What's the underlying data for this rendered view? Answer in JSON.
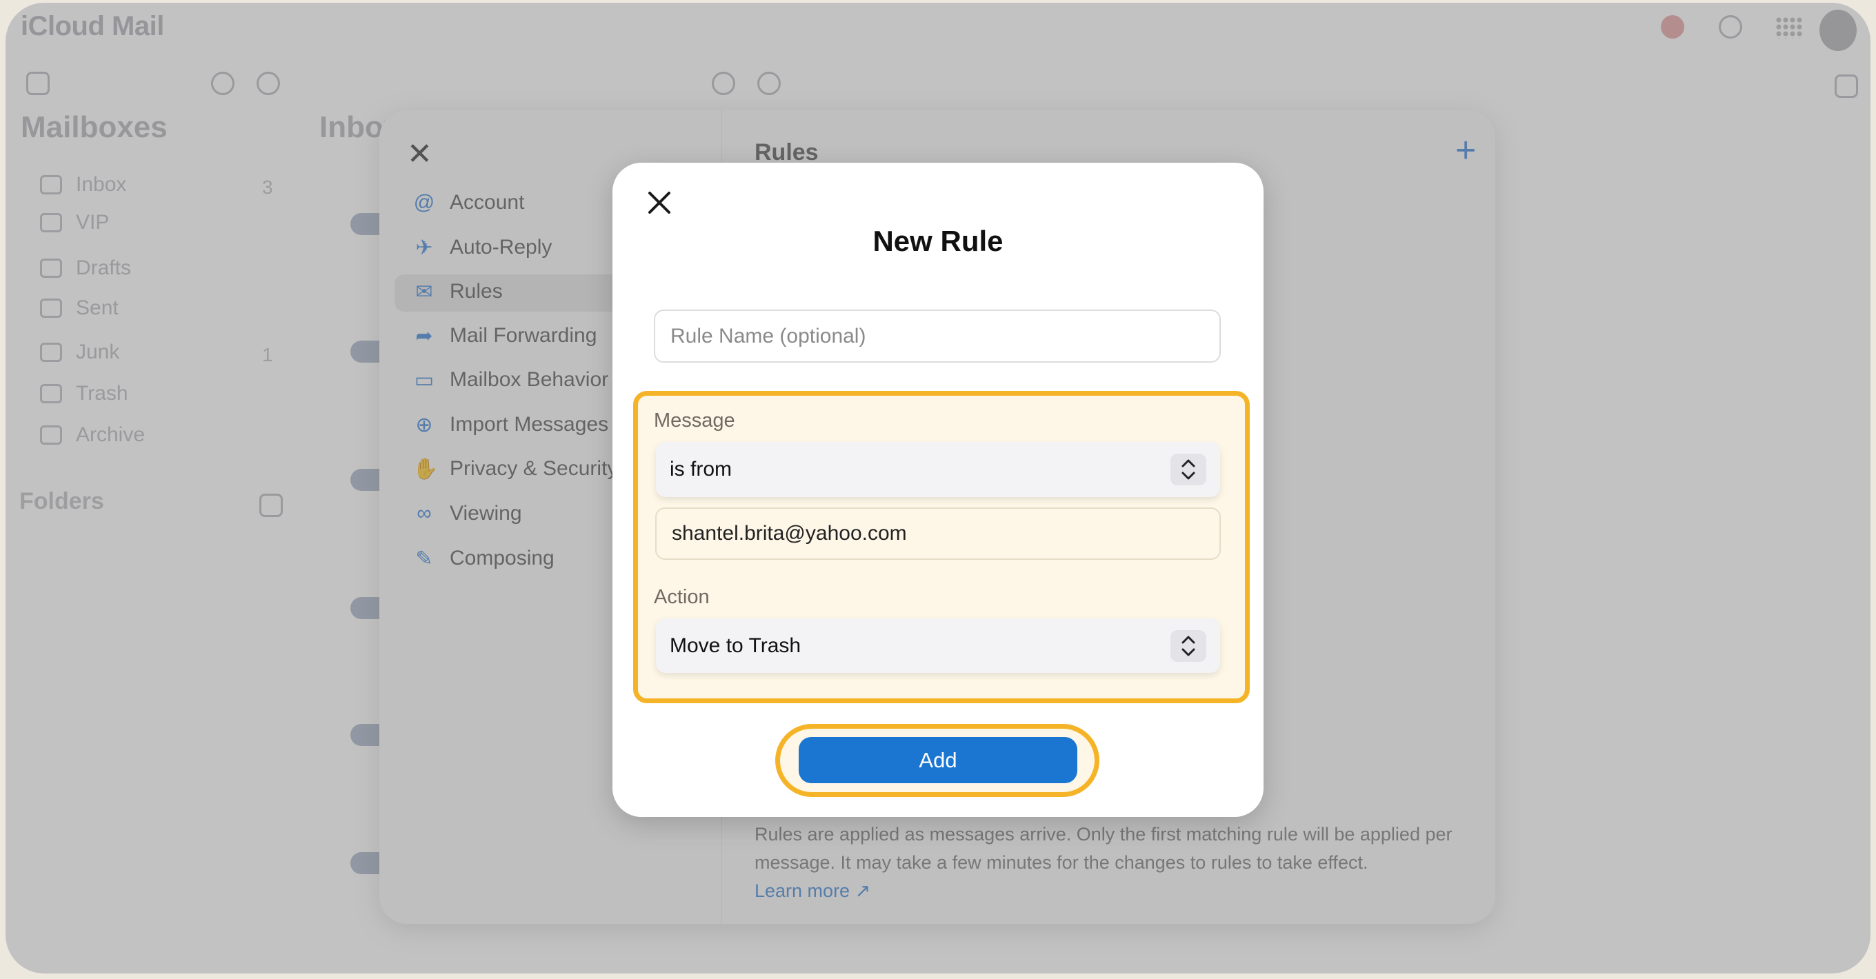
{
  "app": {
    "title": "iCloud Mail"
  },
  "sidebar": {
    "heading": "Mailboxes",
    "items": [
      {
        "label": "Inbox",
        "count": "3"
      },
      {
        "label": "VIP",
        "count": ""
      },
      {
        "label": "Drafts",
        "count": ""
      },
      {
        "label": "Sent",
        "count": ""
      },
      {
        "label": "Junk",
        "count": "1"
      },
      {
        "label": "Trash",
        "count": ""
      },
      {
        "label": "Archive",
        "count": ""
      }
    ],
    "folders_heading": "Folders"
  },
  "message_list": {
    "heading": "Inbox"
  },
  "settings": {
    "menu": [
      {
        "label": "Account",
        "icon": "@"
      },
      {
        "label": "Auto-Reply",
        "icon": "✈"
      },
      {
        "label": "Rules",
        "icon": "✉"
      },
      {
        "label": "Mail Forwarding",
        "icon": "➦"
      },
      {
        "label": "Mailbox Behavior",
        "icon": "▭"
      },
      {
        "label": "Import Messages",
        "icon": "⊕"
      },
      {
        "label": "Privacy & Security",
        "icon": "✋"
      },
      {
        "label": "Viewing",
        "icon": "∞"
      },
      {
        "label": "Composing",
        "icon": "✎"
      }
    ],
    "active": "Rules",
    "rules_heading": "Rules",
    "footer_text": "Rules are applied as messages arrive. Only the first matching rule will be applied per message. It may take a few minutes for the changes to rules to take effect.",
    "learn_more": "Learn more ↗"
  },
  "modal": {
    "title": "New Rule",
    "rule_name_placeholder": "Rule Name (optional)",
    "message_label": "Message",
    "condition_value": "is from",
    "email_value": "shantel.brita@yahoo.com",
    "action_label": "Action",
    "action_value": "Move to Trash",
    "add_label": "Add"
  },
  "colors": {
    "accent": "#1b76d2",
    "highlight": "#f5b428",
    "highlight_bg": "#fef7e8"
  }
}
